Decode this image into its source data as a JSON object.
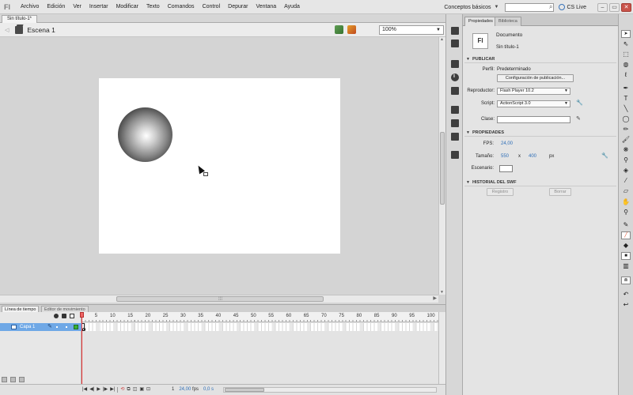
{
  "app": {
    "logo": "Fl",
    "menu": [
      "Archivo",
      "Edición",
      "Ver",
      "Insertar",
      "Modificar",
      "Texto",
      "Comandos",
      "Control",
      "Depurar",
      "Ventana",
      "Ayuda"
    ],
    "workspace": "Conceptos básicos",
    "search_placeholder": "",
    "cs_live": "CS Live",
    "window_buttons": [
      "–",
      "▭",
      "✕"
    ]
  },
  "document": {
    "tab_title": "Sin título-1*",
    "scene": "Escena 1",
    "zoom": "100%"
  },
  "timeline": {
    "tabs": [
      "Línea de tiempo",
      "Editor de movimiento"
    ],
    "layer": {
      "name": "Capa 1"
    },
    "ruler": [
      1,
      5,
      10,
      15,
      20,
      25,
      30,
      35,
      40,
      45,
      50,
      55,
      60,
      65,
      70,
      75,
      80,
      85,
      90,
      95,
      100
    ],
    "status": {
      "frame": "1",
      "fps": "24,00",
      "fps_unit": "fps",
      "time": "0,0 s"
    }
  },
  "properties": {
    "tabs": [
      "Propiedades",
      "Biblioteca"
    ],
    "doc_icon": "Fl",
    "doc_type": "Documento",
    "doc_name": "Sin título-1",
    "sections": {
      "publicar": "PUBLICAR",
      "propiedades": "PROPIEDADES",
      "historial": "HISTORIAL DEL SWF"
    },
    "perfil_label": "Perfil:",
    "perfil_value": "Predeterminado",
    "config_button": "Configuración de publicación...",
    "reproductor_label": "Reproductor:",
    "reproductor_value": "Flash Player 10.2",
    "script_label": "Script:",
    "script_value": "ActionScript 3.0",
    "clase_label": "Clase:",
    "clase_value": "",
    "fps_label": "FPS:",
    "fps_value": "24,00",
    "tamano_label": "Tamaño:",
    "width": "550",
    "x": "x",
    "height": "400",
    "px": "px",
    "escenario_label": "Escenario:",
    "stage_color": "#ffffff",
    "registro_button": "Registro",
    "borrar_button": "Borrar"
  }
}
